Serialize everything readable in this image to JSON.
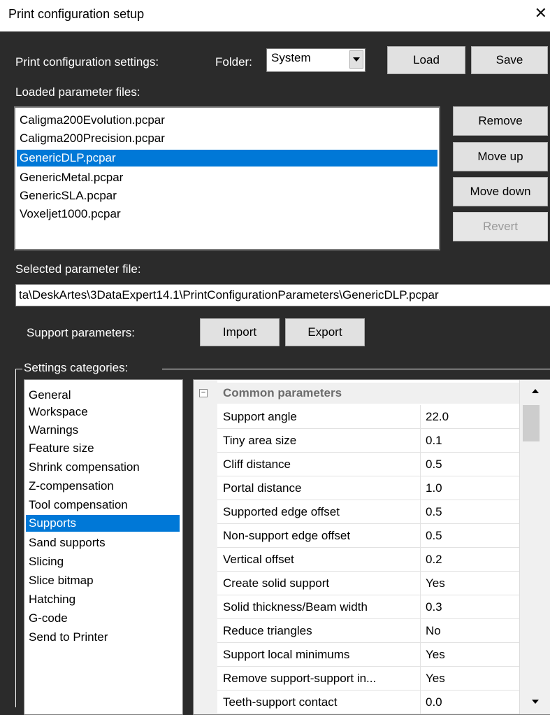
{
  "window": {
    "title": "Print configuration setup",
    "close_glyph": "✕"
  },
  "settings": {
    "label": "Print configuration settings:",
    "folder_label": "Folder:",
    "folder_value": "System",
    "load_label": "Load",
    "save_label": "Save"
  },
  "loaded_files": {
    "label": "Loaded parameter files:",
    "items": [
      "Caligma200Evolution.pcpar",
      "Caligma200Precision.pcpar",
      "GenericDLP.pcpar",
      "GenericMetal.pcpar",
      "GenericSLA.pcpar",
      "Voxeljet1000.pcpar"
    ],
    "selected": "GenericDLP.pcpar",
    "buttons": {
      "remove": "Remove",
      "move_up": "Move up",
      "move_down": "Move down",
      "revert": "Revert"
    }
  },
  "selected_file": {
    "label": "Selected parameter file:",
    "path": "ta\\DeskArtes\\3DataExpert14.1\\PrintConfigurationParameters\\GenericDLP.pcpar"
  },
  "support_params": {
    "label": "Support parameters:",
    "import_label": "Import",
    "export_label": "Export"
  },
  "categories": {
    "group_label": "Settings categories:",
    "items": [
      "General",
      "Workspace",
      "Warnings",
      "Feature size",
      "Shrink compensation",
      "Z-compensation",
      "Tool compensation",
      "Supports",
      "Sand supports",
      "Slicing",
      "Slice bitmap",
      "Hatching",
      "G-code",
      "Send to Printer"
    ],
    "selected": "Supports"
  },
  "property_grid": {
    "category_title": "Common parameters",
    "expander_glyph": "⊟",
    "rows": [
      {
        "name": "Support angle",
        "value": "22.0"
      },
      {
        "name": "Tiny area size",
        "value": "0.1"
      },
      {
        "name": "Cliff distance",
        "value": "0.5"
      },
      {
        "name": "Portal distance",
        "value": "1.0"
      },
      {
        "name": "Supported edge offset",
        "value": "0.5"
      },
      {
        "name": "Non-support edge offset",
        "value": "0.5"
      },
      {
        "name": "Vertical offset",
        "value": "0.2"
      },
      {
        "name": "Create solid support",
        "value": "Yes"
      },
      {
        "name": "Solid thickness/Beam width",
        "value": "0.3"
      },
      {
        "name": "Reduce triangles",
        "value": "No"
      },
      {
        "name": "Support local minimums",
        "value": "Yes"
      },
      {
        "name": "Remove support-support in...",
        "value": "Yes"
      },
      {
        "name": "Teeth-support contact",
        "value": "0.0"
      }
    ]
  },
  "colors": {
    "background": "#2b2b2b",
    "selection": "#0078d7"
  }
}
